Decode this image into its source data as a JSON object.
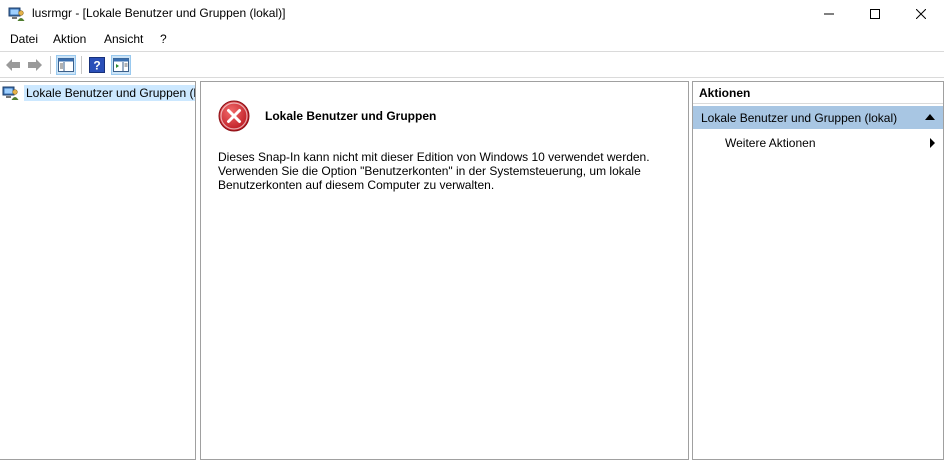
{
  "window": {
    "title": "lusrmgr - [Lokale Benutzer und Gruppen (lokal)]",
    "icon": "users-groups-icon",
    "controls": [
      "minimize-icon",
      "maximize-icon",
      "close-icon"
    ]
  },
  "menu": {
    "items": [
      "Datei",
      "Aktion",
      "Ansicht",
      "?"
    ]
  },
  "toolbar": {
    "buttons": [
      "back-arrow-icon",
      "forward-arrow-icon",
      "show-hide-console-tree-icon",
      "help-icon",
      "show-hide-action-pane-icon"
    ]
  },
  "tree": {
    "root_label": "Lokale Benutzer und Gruppen (lokal)",
    "root_icon": "users-groups-icon"
  },
  "content": {
    "error_icon": "error-icon",
    "error_title": "Lokale Benutzer und Gruppen",
    "error_message": "Dieses Snap-In kann nicht mit dieser Edition von Windows 10 verwendet werden. Verwenden Sie die Option \"Benutzerkonten\" in der Systemsteuerung, um lokale Benutzerkonten auf diesem Computer zu verwalten."
  },
  "actions": {
    "header": "Aktionen",
    "group_label": "Lokale Benutzer und Gruppen (lokal)",
    "items": [
      "Weitere Aktionen"
    ]
  },
  "colors": {
    "selection": "#cce8ff",
    "actions_group": "#a8c6e3",
    "error_red": "#d0021b",
    "pane_border": "#a0a0a0"
  }
}
